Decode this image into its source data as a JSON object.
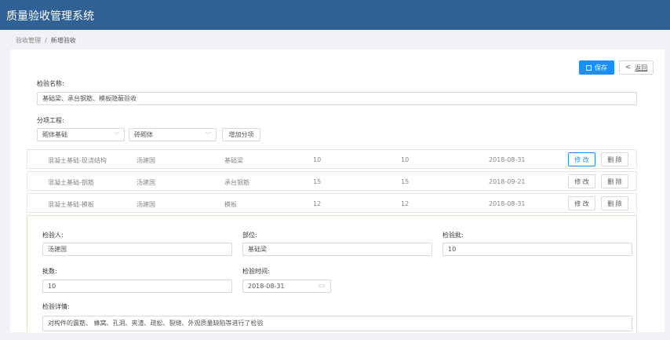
{
  "app": {
    "title": "质量验收管理系统"
  },
  "breadcrumb": {
    "parent": "验收管理",
    "separator": "/",
    "current": "新增验收"
  },
  "toolbar": {
    "save_icon": "save-icon",
    "save_label": "保存",
    "back_icon": "chevron-left-icon",
    "back_label": "返回"
  },
  "form": {
    "name_label": "检验名称:",
    "name_value": "基础梁、承台钢筋、模板隐蔽验收",
    "sub_label": "分项工程:",
    "sub_select1": "砌体基础",
    "sub_select2": "砖砌体",
    "add_button": "增加分项"
  },
  "rows": [
    {
      "name": "混凝土基础-现浇结构",
      "person": "汤建国",
      "part": "基础梁",
      "batch": "10",
      "count": "10",
      "date": "2018-08-31",
      "edit": "修 改",
      "del": "删 除"
    },
    {
      "name": "混凝土基础-钢筋",
      "person": "汤建国",
      "part": "承台钢筋",
      "batch": "15",
      "count": "15",
      "date": "2018-09-21",
      "edit": "修 改",
      "del": "删 除"
    },
    {
      "name": "混凝土基础-模板",
      "person": "汤建国",
      "part": "模板",
      "batch": "12",
      "count": "12",
      "date": "2018-08-31",
      "edit": "修 改",
      "del": "删 除"
    }
  ],
  "detail": {
    "inspector_label": "检验人:",
    "inspector_value": "汤建国",
    "part_label": "部位:",
    "part_value": "基础梁",
    "batch_label": "检验批:",
    "batch_value": "10",
    "count_label": "批数:",
    "count_value": "10",
    "time_label": "检验时间:",
    "time_value": "2018-08-31",
    "desc_label": "检验详情:",
    "desc_value": "对构件的露筋、    蜂窝、孔洞、夹渣、疏松、裂缝、外观质量缺陷等进行了检验"
  },
  "colors": {
    "header": "#2f6196",
    "primary": "#1890ff"
  }
}
